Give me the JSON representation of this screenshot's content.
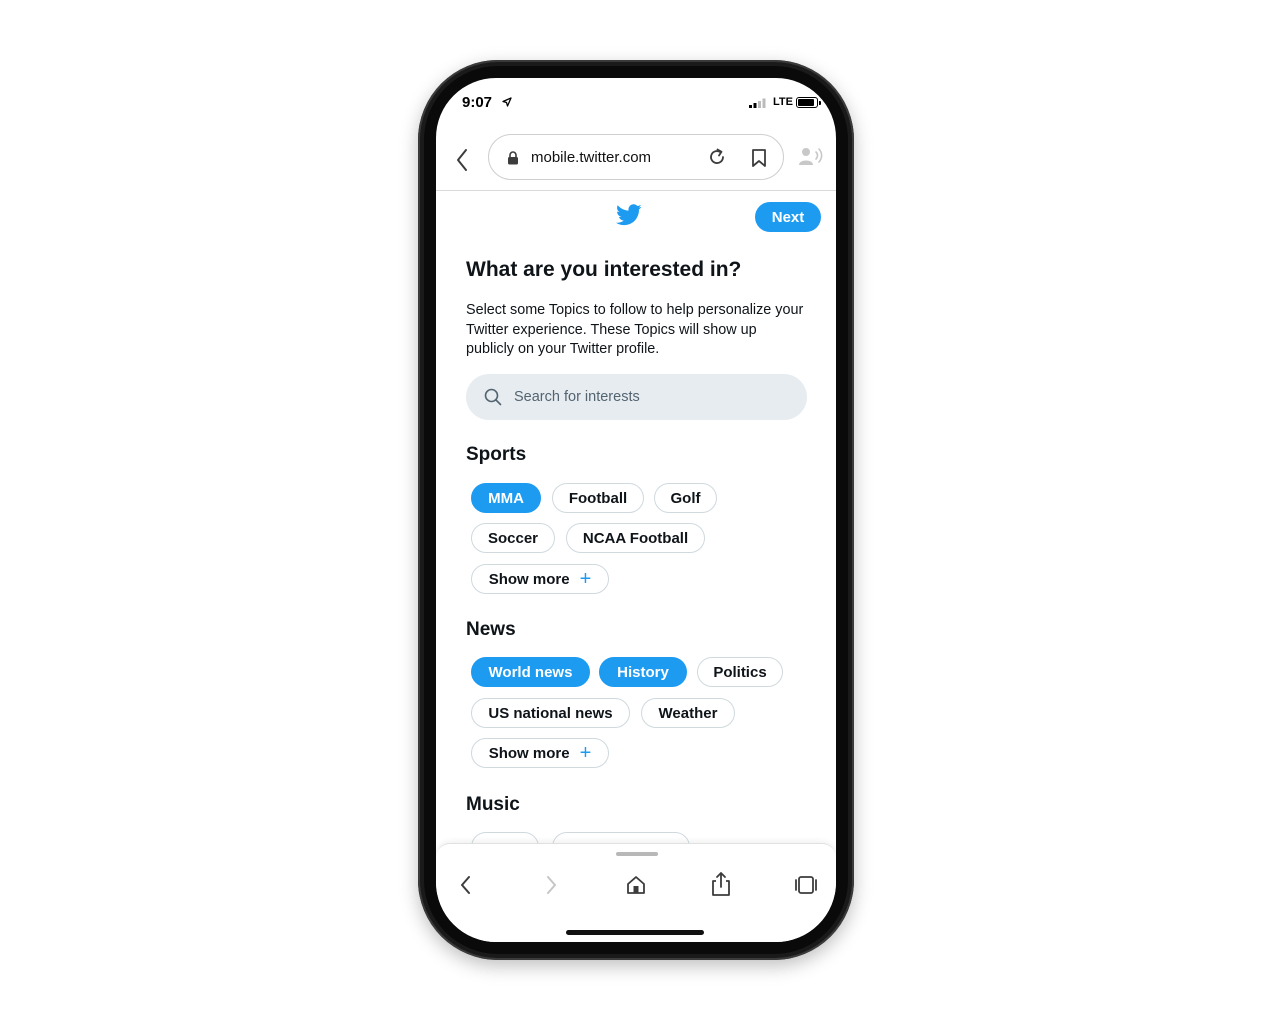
{
  "status_bar": {
    "time": "9:07",
    "network": "LTE"
  },
  "browser": {
    "url": "mobile.twitter.com"
  },
  "header": {
    "next_label": "Next"
  },
  "main": {
    "title": "What are you interested in?",
    "description": "Select some Topics to follow to help personalize your Twitter experience. These Topics will show up publicly on your Twitter profile.",
    "search": {
      "placeholder": "Search for interests"
    },
    "sections": [
      {
        "title": "Sports",
        "chips": [
          {
            "label": "MMA",
            "selected": true
          },
          {
            "label": "Football",
            "selected": false
          },
          {
            "label": "Golf",
            "selected": false
          },
          {
            "label": "Soccer",
            "selected": false
          },
          {
            "label": "NCAA Football",
            "selected": false
          }
        ],
        "show_more": "Show more"
      },
      {
        "title": "News",
        "chips": [
          {
            "label": "World news",
            "selected": true
          },
          {
            "label": "History",
            "selected": true
          },
          {
            "label": "Politics",
            "selected": false
          },
          {
            "label": "US national news",
            "selected": false
          },
          {
            "label": "Weather",
            "selected": false
          }
        ],
        "show_more": "Show more"
      },
      {
        "title": "Music"
      }
    ]
  },
  "colors": {
    "accent": "#1d9bf0",
    "text": "#0f1419",
    "search_bg": "#e7ecf0"
  },
  "icons": [
    "back-chevron-icon",
    "lock-icon",
    "reload-icon",
    "bookmark-icon",
    "reader-icon",
    "twitter-bird-icon",
    "search-icon",
    "plus-icon",
    "forward-chevron-icon",
    "home-icon",
    "share-icon",
    "tabs-icon"
  ]
}
